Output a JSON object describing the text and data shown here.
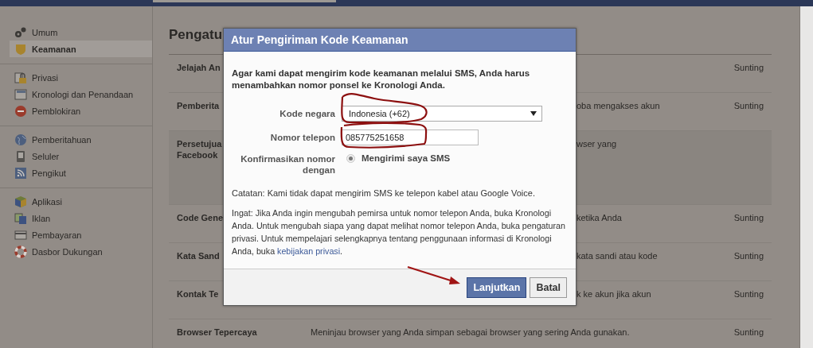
{
  "sidebar": {
    "groups": [
      [
        {
          "label": "Umum",
          "selected": false
        },
        {
          "label": "Keamanan",
          "selected": true
        }
      ],
      [
        {
          "label": "Privasi",
          "selected": false
        },
        {
          "label": "Kronologi dan Penandaan",
          "selected": false
        },
        {
          "label": "Pemblokiran",
          "selected": false
        }
      ],
      [
        {
          "label": "Pemberitahuan",
          "selected": false
        },
        {
          "label": "Seluler",
          "selected": false
        },
        {
          "label": "Pengikut",
          "selected": false
        }
      ],
      [
        {
          "label": "Aplikasi",
          "selected": false
        },
        {
          "label": "Iklan",
          "selected": false
        },
        {
          "label": "Pembayaran",
          "selected": false
        },
        {
          "label": "Dasbor Dukungan",
          "selected": false
        }
      ]
    ]
  },
  "content": {
    "title": "Pengatu",
    "rows": [
      {
        "name_lines": [
          "Jelajah An"
        ],
        "description": "",
        "action": "Sunting",
        "expanded": false
      },
      {
        "name_lines": [
          "Pemberita"
        ],
        "description": "oba mengakses akun",
        "action": "Sunting",
        "expanded": false
      },
      {
        "name_lines": [
          "Persetujua",
          "Facebook"
        ],
        "description": "wser yang",
        "action": "",
        "expanded": true
      },
      {
        "name_lines": [
          "Code Gene"
        ],
        "description": "ketika Anda",
        "action": "Sunting",
        "expanded": false
      },
      {
        "name_lines": [
          "Kata Sand"
        ],
        "description": "kata sandi atau kode",
        "action": "Sunting",
        "expanded": false
      },
      {
        "name_lines": [
          "Kontak Te"
        ],
        "description": "k ke akun jika akun",
        "action": "Sunting",
        "expanded": false
      },
      {
        "name_lines": [
          "Browser Tepercaya"
        ],
        "description": "Meninjau browser yang Anda simpan sebagai browser yang sering Anda gunakan.",
        "action": "Sunting",
        "expanded": false
      }
    ]
  },
  "dialog": {
    "title": "Atur Pengiriman Kode Keamanan",
    "intro": "Agar kami dapat mengirim kode keamanan melalui SMS, Anda harus menambahkan nomor ponsel ke Kronologi Anda.",
    "country_label": "Kode negara",
    "country_value": "Indonesia (+62)",
    "phone_label": "Nomor telepon",
    "phone_value": "085775251658",
    "confirm_label": "Konfirmasikan nomor dengan",
    "confirm_option": {
      "label": "Mengirimi saya SMS",
      "selected": true
    },
    "note": "Catatan: Kami tidak dapat mengirim SMS ke telepon kabel atau Google Voice.",
    "reminder_before": "Ingat: Jika Anda ingin mengubah pemirsa untuk nomor telepon Anda, buka Kronologi Anda. Untuk mengubah siapa yang dapat melihat nomor telepon Anda, buka pengaturan privasi. Untuk mempelajari selengkapnya tentang penggunaan informasi di Kronologi Anda, buka ",
    "reminder_link": "kebijakan privasi",
    "reminder_after": ".",
    "buttons": [
      "Lanjutkan",
      "Batal"
    ]
  }
}
